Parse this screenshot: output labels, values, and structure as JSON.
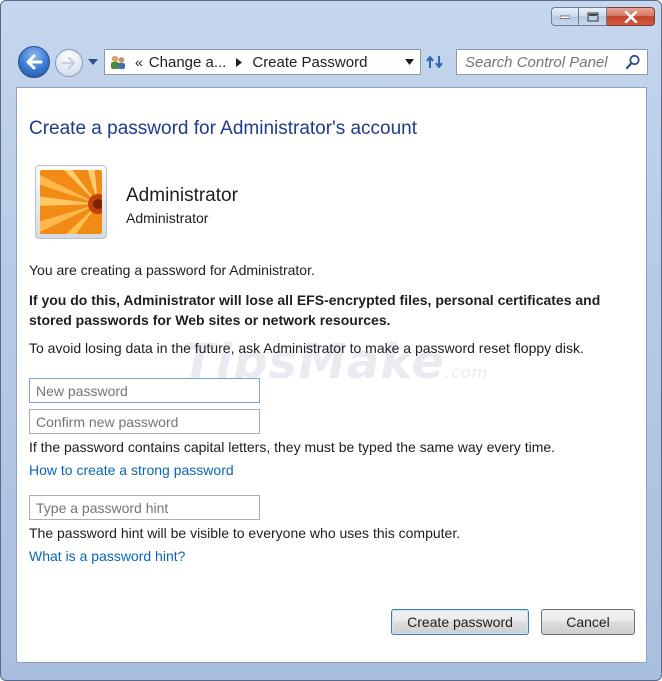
{
  "navbar": {
    "breadcrumb": [
      "Change a...",
      "Create Password"
    ],
    "breadcrumb_prefix": "«",
    "search_placeholder": "Search Control Panel"
  },
  "page": {
    "title": "Create a password for Administrator's account",
    "user_name": "Administrator",
    "user_type": "Administrator",
    "intro": "You are creating a password for Administrator.",
    "warning": "If you do this, Administrator will lose all EFS-encrypted files, personal certificates and stored passwords for Web sites or network resources.",
    "avoid_note": "To avoid losing data in the future, ask Administrator to make a password reset floppy disk.",
    "new_password_placeholder": "New password",
    "confirm_password_placeholder": "Confirm new password",
    "case_note": "If the password contains capital letters, they must be typed the same way every time.",
    "strong_password_link": "How to create a strong password",
    "hint_placeholder": "Type a password hint",
    "hint_note": "The password hint will be visible to everyone who uses this computer.",
    "hint_link": "What is a password hint?"
  },
  "buttons": {
    "create": "Create password",
    "cancel": "Cancel"
  },
  "watermark": {
    "brand": "TipsMake",
    "suffix": ".com"
  },
  "colors": {
    "title": "#1e3b8c",
    "link": "#0a66b7",
    "chrome": "#b7cbe6"
  }
}
